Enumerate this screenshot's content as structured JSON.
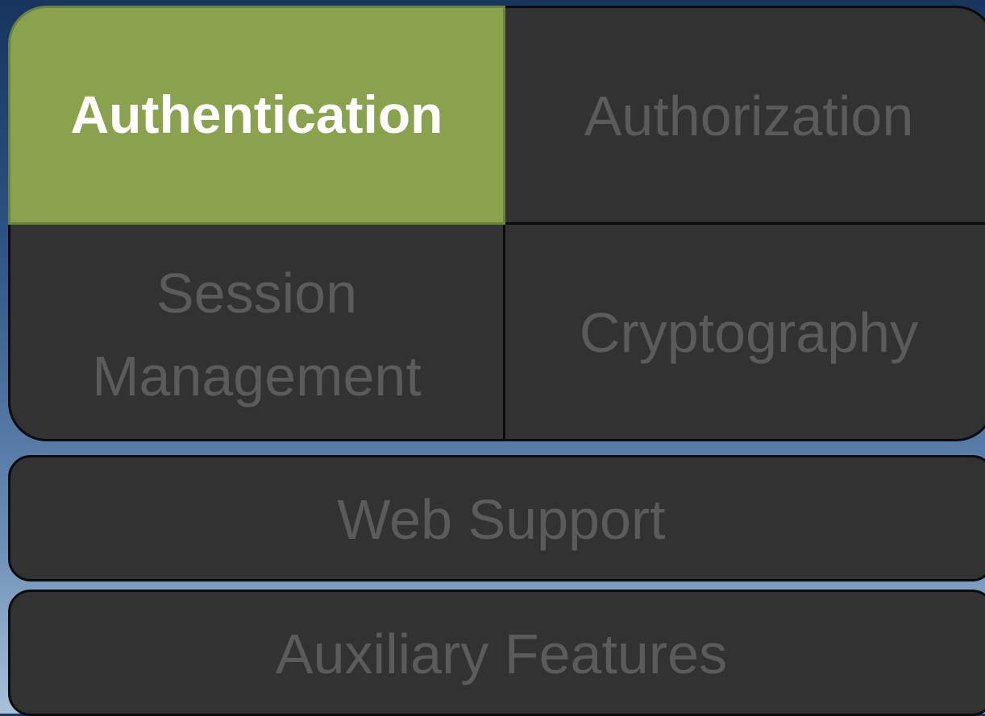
{
  "blocks": {
    "authentication": "Authentication",
    "authorization": "Authorization",
    "session_management_line1": "Session",
    "session_management_line2": "Management",
    "cryptography": "Cryptography",
    "web_support": "Web Support",
    "auxiliary_features": "Auxiliary Features"
  },
  "colors": {
    "selected": "#8aa14d",
    "block": "#323232",
    "inactive_text": "#5b5b5b",
    "selected_text": "#ffffff"
  }
}
